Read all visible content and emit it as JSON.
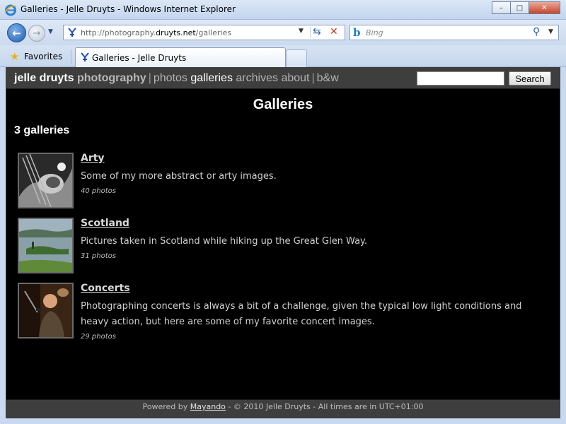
{
  "window": {
    "title": "Galleries - Jelle Druyts - Windows Internet Explorer",
    "controls": {
      "minimize": "–",
      "maximize": "□",
      "close": "✕"
    }
  },
  "address_bar": {
    "url_prefix": "http://photography.",
    "url_domain": "druyts.net",
    "url_suffix": "/galleries"
  },
  "search_box": {
    "placeholder": "Bing",
    "provider_icon": "b"
  },
  "favorites": {
    "label": "Favorites"
  },
  "tab": {
    "label": "Galleries - Jelle Druyts"
  },
  "site": {
    "brand": "jelle druyts",
    "brand_sub": "photography",
    "nav": [
      {
        "label": "photos",
        "current": false
      },
      {
        "label": "galleries",
        "current": true
      },
      {
        "label": "archives",
        "current": false
      },
      {
        "label": "about",
        "current": false
      },
      {
        "label": "b&w",
        "current": false
      }
    ],
    "search_button": "Search",
    "search_value": ""
  },
  "main": {
    "title": "Galleries",
    "count": "3 galleries",
    "galleries": [
      {
        "name": "Arty",
        "description": "Some of my more abstract or arty images.",
        "count": "40 photos"
      },
      {
        "name": "Scotland",
        "description": "Pictures taken in Scotland while hiking up the Great Glen Way.",
        "count": "31 photos"
      },
      {
        "name": "Concerts",
        "description": "Photographing concerts is always a bit of a challenge, given the typical low light conditions and heavy action, but here are some of my favorite concert images.",
        "count": "29 photos"
      }
    ]
  },
  "footer": {
    "prefix": "Powered by ",
    "link": "Mayando",
    "suffix": " - © 2010 Jelle Druyts - All times are in UTC+01:00"
  }
}
